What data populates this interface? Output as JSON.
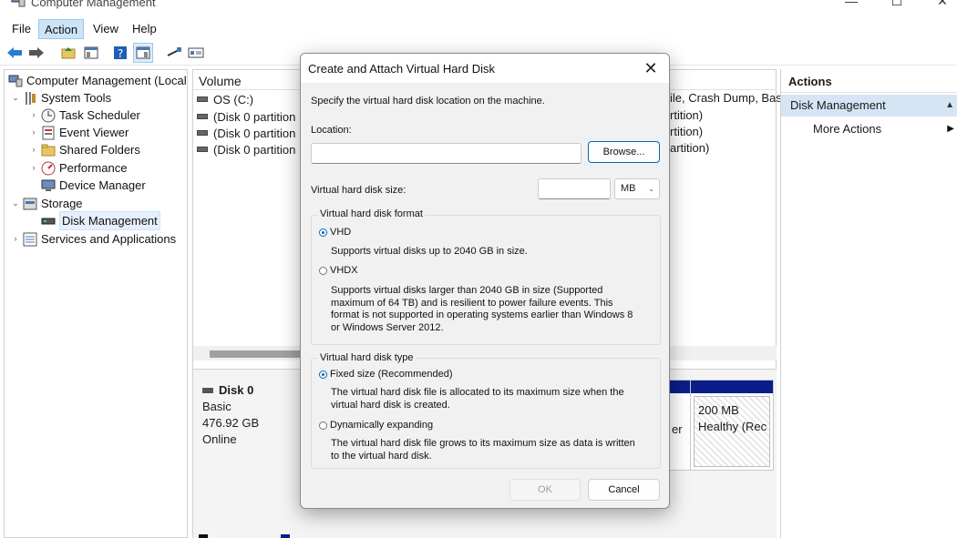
{
  "window": {
    "title": "Computer Management"
  },
  "menu": [
    "File",
    "Action",
    "View",
    "Help"
  ],
  "tree": {
    "root": "Computer Management (Local)",
    "system_tools": "System Tools",
    "task_scheduler": "Task Scheduler",
    "event_viewer": "Event Viewer",
    "shared_folders": "Shared Folders",
    "performance": "Performance",
    "device_manager": "Device Manager",
    "storage": "Storage",
    "disk_management": "Disk Management",
    "services_apps": "Services and Applications"
  },
  "volumes": {
    "header": "Volume",
    "rows": [
      "OS (C:)",
      "(Disk 0 partition",
      "(Disk 0 partition",
      "(Disk 0 partition"
    ],
    "right_cells": [
      "ile, Crash Dump, Bas",
      "rtition)",
      "rtition)",
      "artition)"
    ]
  },
  "disk": {
    "name": "Disk 0",
    "type": "Basic",
    "size": "476.92 GB",
    "status": "Online",
    "partition_left_fragment": "er",
    "partition_right": {
      "size": "200 MB",
      "status": "Healthy (Rec"
    }
  },
  "actions": {
    "header": "Actions",
    "section": "Disk Management",
    "more": "More Actions"
  },
  "dialog": {
    "title": "Create and Attach Virtual Hard Disk",
    "instruction": "Specify the virtual hard disk location on the machine.",
    "location_label": "Location:",
    "location_value": "",
    "browse": "Browse...",
    "size_label": "Virtual hard disk size:",
    "size_value": "",
    "size_unit": "MB",
    "format_group": "Virtual hard disk format",
    "vhd_label": "VHD",
    "vhd_desc": "Supports virtual disks up to 2040 GB in size.",
    "vhdx_label": "VHDX",
    "vhdx_desc": [
      "Supports virtual disks larger than 2040 GB in size (Supported",
      "maximum of 64 TB) and is resilient to power failure events. This",
      "format is not supported in operating systems earlier than Windows 8",
      "or Windows Server 2012."
    ],
    "type_group": "Virtual hard disk type",
    "fixed_label": "Fixed size (Recommended)",
    "fixed_desc": [
      "The virtual hard disk file is allocated to its maximum size when the",
      "virtual hard disk is created."
    ],
    "dynamic_label": "Dynamically expanding",
    "dynamic_desc": [
      "The virtual hard disk file grows to its maximum size as data is written",
      "to the virtual hard disk."
    ],
    "ok": "OK",
    "cancel": "Cancel",
    "selected_format": "VHD",
    "selected_type": "Fixed size (Recommended)"
  },
  "colors": {
    "accent": "#0067c0",
    "selection": "#cce4f7",
    "partition_bar": "#0a1e8a"
  }
}
